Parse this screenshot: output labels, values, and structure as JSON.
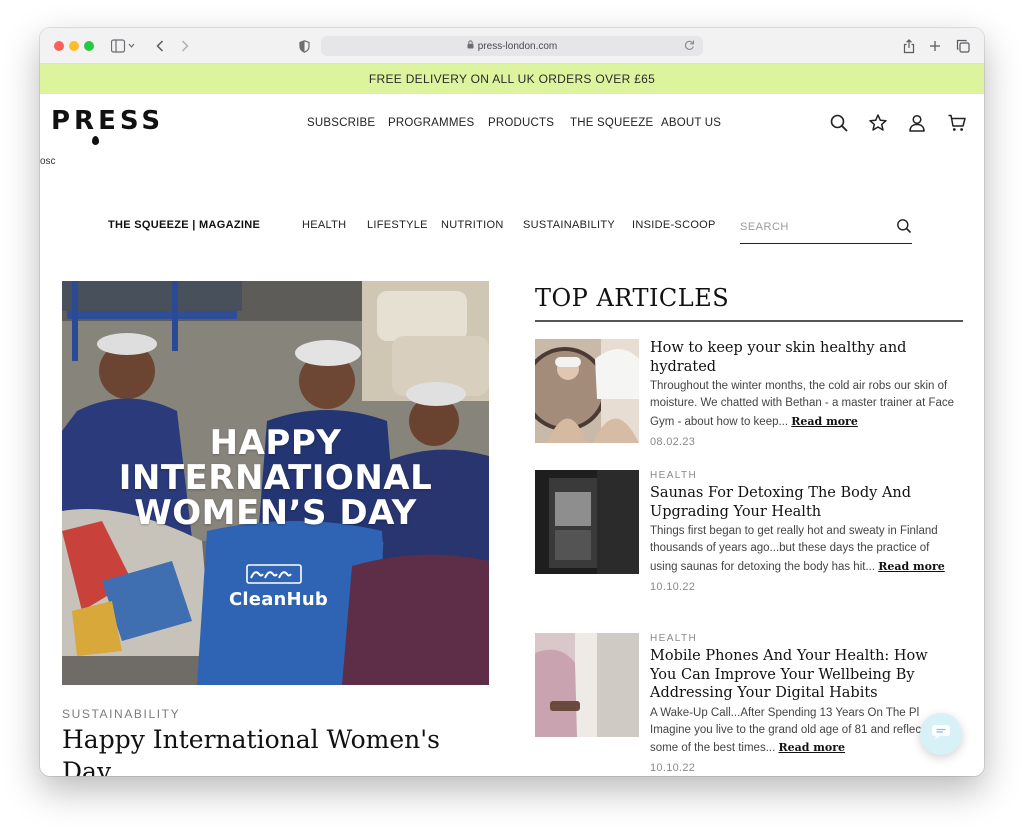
{
  "browser": {
    "url": "press-london.com"
  },
  "promo": {
    "text": "FREE DELIVERY ON ALL UK ORDERS OVER £65"
  },
  "header": {
    "logo": "PRESS",
    "nav": [
      "SUBSCRIBE",
      "PROGRAMMES",
      "PRODUCTS",
      "THE SQUEEZE",
      "ABOUT US"
    ],
    "icons": [
      "search-icon",
      "star-icon",
      "account-icon",
      "cart-icon"
    ]
  },
  "stray_text": "osc",
  "magazine": {
    "title": "THE SQUEEZE | MAGAZINE",
    "nav": [
      "HEALTH",
      "LIFESTYLE",
      "NUTRITION",
      "SUSTAINABILITY",
      "INSIDE-SCOOP"
    ],
    "search_placeholder": "SEARCH"
  },
  "hero": {
    "image_text_lines": [
      "HAPPY",
      "INTERNATIONAL",
      "WOMEN’S DAY"
    ],
    "image_brand": "CleanHub",
    "category": "SUSTAINABILITY",
    "title": "Happy International Women's Day"
  },
  "top_articles": {
    "heading": "TOP ARTICLES",
    "items": [
      {
        "category": "",
        "title": "How to keep your skin healthy and hydrated",
        "excerpt": "Throughout the winter months, the cold air robs our skin of moisture. We chatted with Bethan - a master trainer at Face Gym - about how to keep...",
        "more": "Read more",
        "date": "08.02.23"
      },
      {
        "category": "HEALTH",
        "title": "Saunas For Detoxing The Body And Upgrading Your Health",
        "excerpt": "Things first began to get really hot and sweaty in Finland thousands of years ago...but these days the practice of using saunas for detoxing the body has hit...",
        "more": "Read more",
        "date": "10.10.22"
      },
      {
        "category": "HEALTH",
        "title": "Mobile Phones And Your Health: How You Can Improve Your Wellbeing By Addressing Your Digital Habits",
        "excerpt": "A Wake-Up Call...After Spending 13 Years On The Pl Imagine you live to the grand old age of 81 and reflect on some of the best times...",
        "more": "Read more",
        "date": "10.10.22"
      }
    ]
  },
  "colors": {
    "promo_bg": "#ddf49f",
    "chat_bg": "#d8f1f7"
  }
}
